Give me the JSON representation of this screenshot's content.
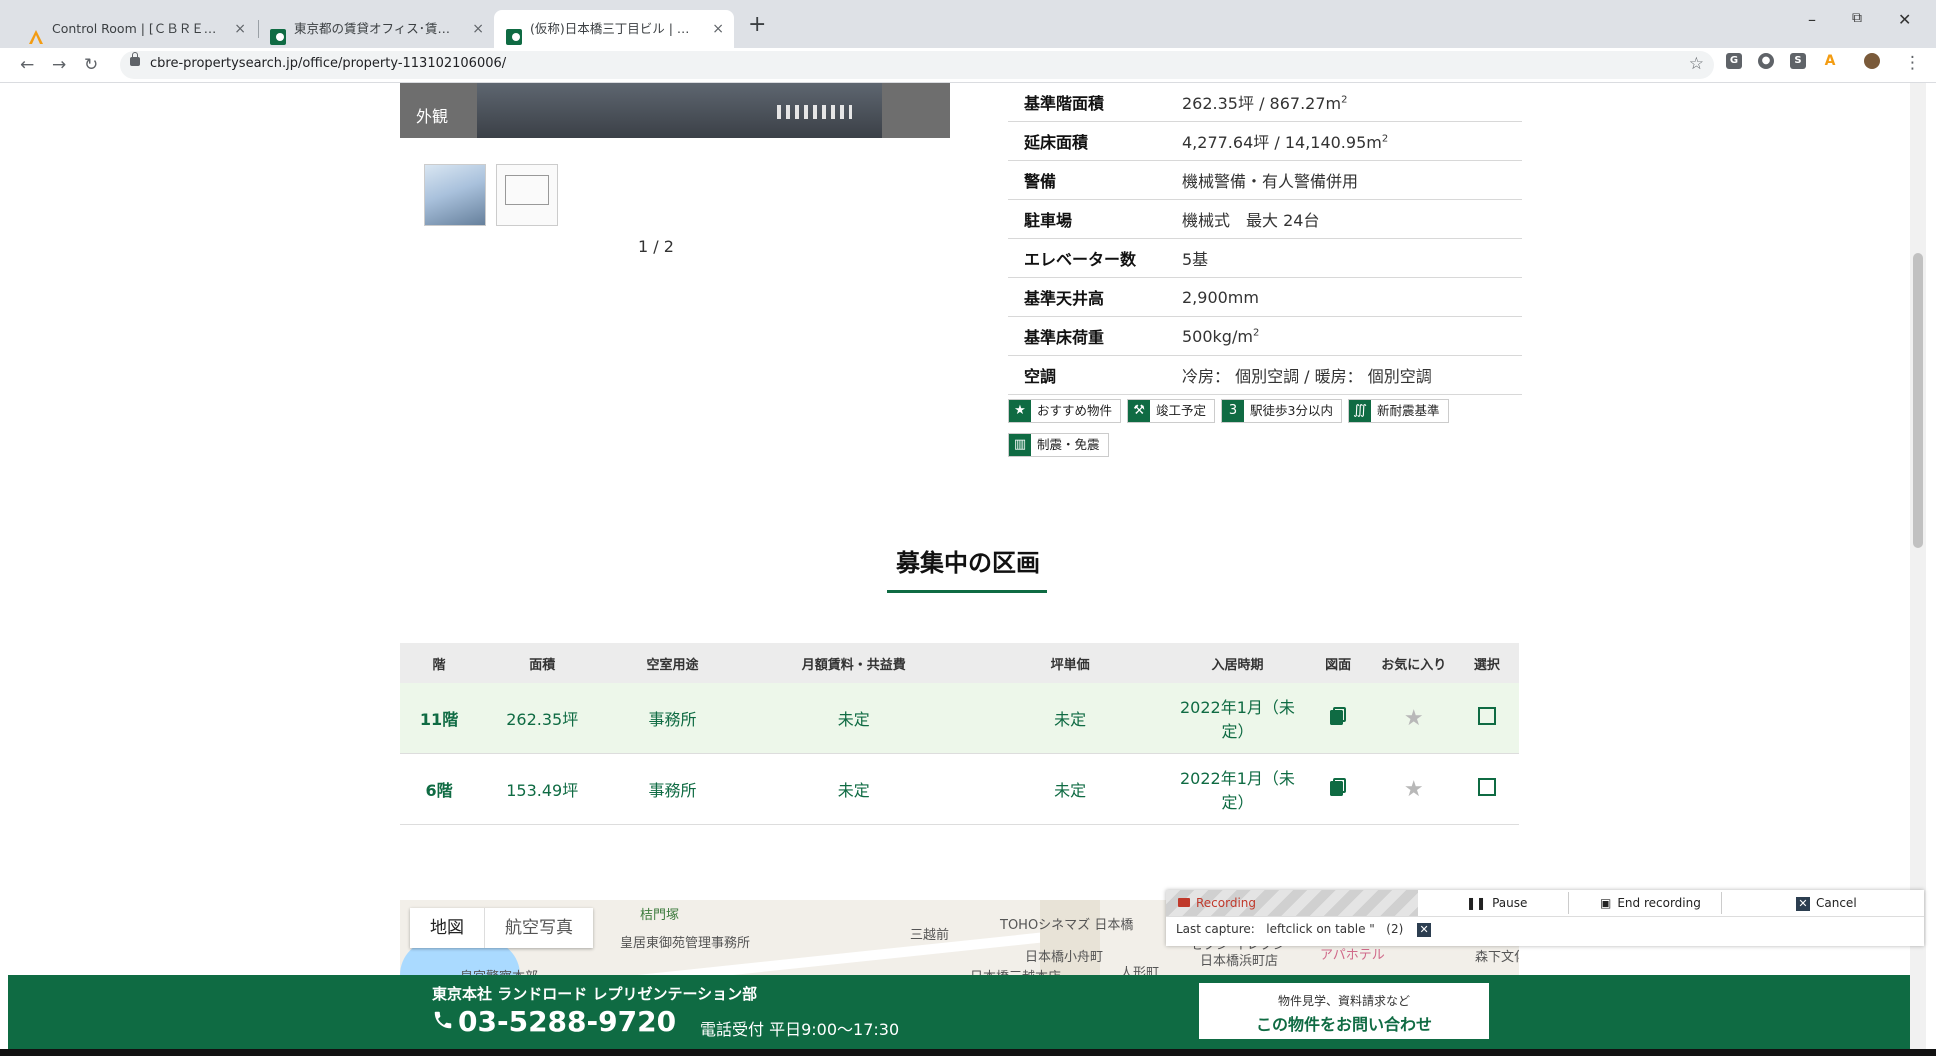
{
  "browser": {
    "tabs": [
      {
        "title": "Control Room | [ＣＢＲＥ_明細同",
        "favicon": "a-logo",
        "active": false
      },
      {
        "title": "東京都の賃貸オフィス･賃貸事務所",
        "favicon": "cbre-logo",
        "active": false
      },
      {
        "title": "(仮称)日本橋三丁目ビル | 賃貸オフ",
        "favicon": "cbre-logo",
        "active": true
      }
    ],
    "close_glyph": "×",
    "new_tab_glyph": "+",
    "window": {
      "minimize": "–",
      "maximize": "⧉",
      "close": "✕"
    },
    "nav": {
      "back": "←",
      "forward": "→",
      "reload": "↻"
    },
    "url": "cbre-propertysearch.jp/office/property-113102106006/",
    "bookmark_glyph": "☆",
    "menu_glyph": "⋮"
  },
  "gallery": {
    "caption": "外観",
    "pager": "1 / 2"
  },
  "specs": [
    {
      "label": "基準階面積",
      "value": "262.35坪 / 867.27m",
      "sup": "2"
    },
    {
      "label": "延床面積",
      "value": "4,277.64坪 / 14,140.95m",
      "sup": "2"
    },
    {
      "label": "警備",
      "value": "機械警備・有人警備併用",
      "sup": ""
    },
    {
      "label": "駐車場",
      "value": "機械式　最大 24台",
      "sup": ""
    },
    {
      "label": "エレベーター数",
      "value": "5基",
      "sup": ""
    },
    {
      "label": "基準天井高",
      "value": "2,900mm",
      "sup": ""
    },
    {
      "label": "基準床荷重",
      "value": "500kg/m",
      "sup": "2"
    },
    {
      "label": "空調",
      "value": "冷房： 個別空調 / 暖房： 個別空調",
      "sup": ""
    }
  ],
  "tags": [
    {
      "label": "おすすめ物件",
      "icon": "★"
    },
    {
      "label": "竣工予定",
      "icon": "⚒"
    },
    {
      "label": "駅徒歩3分以内",
      "icon": "3"
    },
    {
      "label": "新耐震基準",
      "icon": "∭"
    },
    {
      "label": "制震・免震",
      "icon": "▥"
    }
  ],
  "section": {
    "title": "募集中の区画"
  },
  "units_table": {
    "headers": [
      "階",
      "面積",
      "空室用途",
      "月額賃料・共益費",
      "坪単価",
      "入居時期",
      "図面",
      "お気に入り",
      "選択"
    ],
    "rows": [
      {
        "floor": "11階",
        "area": "262.35坪",
        "use": "事務所",
        "rent": "未定",
        "unit_price": "未定",
        "move_in": "2022年1月（未定）",
        "highlight": true
      },
      {
        "floor": "6階",
        "area": "153.49坪",
        "use": "事務所",
        "rent": "未定",
        "unit_price": "未定",
        "move_in": "2022年1月（未定）",
        "highlight": false
      }
    ]
  },
  "map": {
    "tabs": [
      "地図",
      "航空写真"
    ],
    "labels": [
      "桔門塚",
      "皇居東御苑管理事務所",
      "皇宮警察本部",
      "三越前",
      "TOHOシネマズ 日本橋",
      "日本橋小舟町",
      "日本橋三越本店",
      "人形町",
      "セブン-イレブン",
      "日本橋浜町店",
      "アパホテル",
      "森下文化"
    ]
  },
  "footer": {
    "office": "東京本社 ランドロード レプリゼンテーション部",
    "phone": "03-5288-9720",
    "hours": "電話受付 平日9:00～17:30",
    "cta_small": "物件見学、資料請求など",
    "cta_large": "この物件をお問い合わせ"
  },
  "recorder": {
    "status": "Recording",
    "pause": "Pause",
    "end": "End recording",
    "cancel": "Cancel",
    "last_capture_label": "Last capture:",
    "last_capture_value": "leftclick on table \"",
    "count": "(2)"
  },
  "colors": {
    "brand": "#0f6b43",
    "highlight_row": "#edf7ea",
    "recording": "#c0392b"
  }
}
